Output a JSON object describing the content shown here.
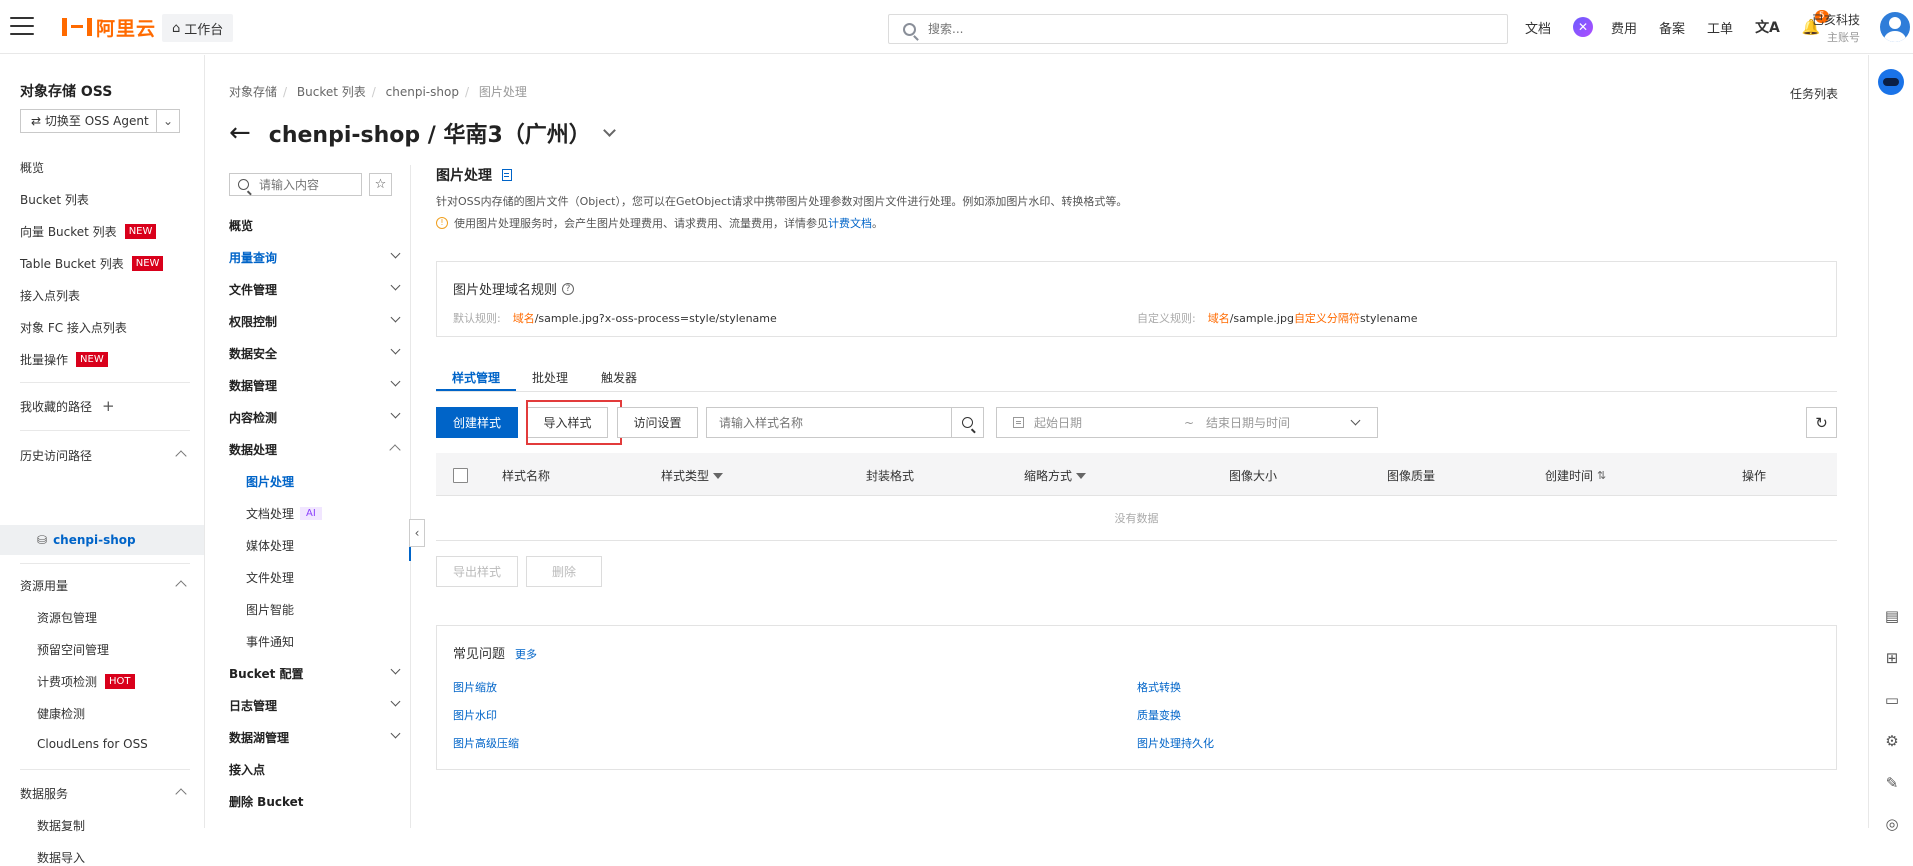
{
  "topbar": {
    "logo_text": "阿里云",
    "workbench": "工作台",
    "search_placeholder": "搜索...",
    "links": [
      "文档",
      "费用",
      "备案",
      "工单"
    ],
    "notification_count": "5",
    "account_name": "已亥科技",
    "account_type": "主账号"
  },
  "leftnav": {
    "title": "对象存储 OSS",
    "switch_label": "切换至 OSS Agent",
    "items": [
      {
        "label": "概览"
      },
      {
        "label": "Bucket 列表"
      },
      {
        "label": "向量 Bucket 列表",
        "tag": "NEW"
      },
      {
        "label": "Table Bucket 列表",
        "tag": "NEW"
      },
      {
        "label": "接入点列表"
      },
      {
        "label": "对象 FC 接入点列表"
      },
      {
        "label": "批量操作",
        "tag": "NEW"
      }
    ],
    "favorites": "我收藏的路径",
    "history": "历史访问路径",
    "history_item": "chenpi-shop",
    "resource": "资源用量",
    "resource_items": [
      "资源包管理",
      "预留空间管理",
      "计费项检测",
      "健康检测",
      "CloudLens for OSS"
    ],
    "hot_tag": "HOT",
    "data_service": "数据服务",
    "data_service_items": [
      "数据复制",
      "数据导入"
    ]
  },
  "breadcrumb": [
    "对象存储",
    "Bucket 列表",
    "chenpi-shop",
    "图片处理"
  ],
  "task_list": "任务列表",
  "page_title": "chenpi-shop / 华南3（广州）",
  "subnav": {
    "search_placeholder": "请输入内容",
    "items": [
      "概览",
      "用量查询",
      "文件管理",
      "权限控制",
      "数据安全",
      "数据管理",
      "内容检测",
      "数据处理"
    ],
    "processing_children": [
      "图片处理",
      "文档处理",
      "媒体处理",
      "文件处理",
      "图片智能",
      "事件通知"
    ],
    "ai_tag": "AI",
    "after_items": [
      "Bucket 配置",
      "日志管理",
      "数据湖管理",
      "接入点",
      "删除 Bucket"
    ]
  },
  "content": {
    "title": "图片处理",
    "desc": "针对OSS内存储的图片文件（Object），您可以在GetObject请求中携带图片处理参数对图片文件进行处理。例如添加图片水印、转换格式等。",
    "notice": "使用图片处理服务时，会产生图片处理费用、请求费用、流量费用，详情参见",
    "notice_link": "计费文档",
    "notice_end": "。",
    "rule_title": "图片处理域名规则",
    "default_rule_label": "默认规则:",
    "default_rule_domain": "域名",
    "default_rule_rest": "/sample.jpg?x-oss-process=style/stylename",
    "custom_rule_label": "自定义规则:",
    "custom_rule_domain": "域名",
    "custom_rule_mid": "/sample.jpg",
    "custom_rule_sep": "自定义分隔符",
    "custom_rule_end": "stylename",
    "tabs": [
      "样式管理",
      "批处理",
      "触发器"
    ],
    "btn_create": "创建样式",
    "btn_import": "导入样式",
    "btn_access": "访问设置",
    "style_search_placeholder": "请输入样式名称",
    "date_start": "起始日期",
    "date_sep": "~",
    "date_end": "结束日期与时间",
    "columns": [
      "样式名称",
      "样式类型",
      "封装格式",
      "缩略方式",
      "图像大小",
      "图像质量",
      "创建时间",
      "操作"
    ],
    "empty": "没有数据",
    "btn_export": "导出样式",
    "btn_delete": "删除",
    "faq_title": "常见问题",
    "faq_more": "更多",
    "faq_links": [
      "图片缩放",
      "图片水印",
      "图片高级压缩",
      "格式转换",
      "质量变换",
      "图片处理持久化"
    ]
  }
}
